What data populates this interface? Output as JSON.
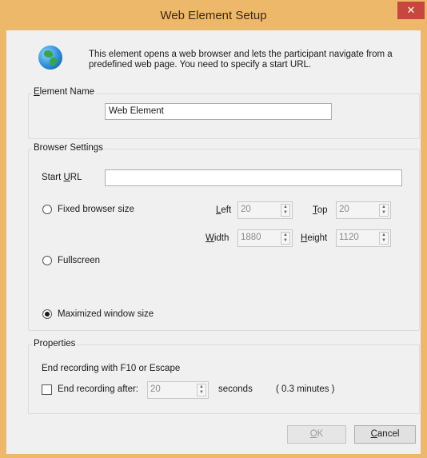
{
  "window": {
    "title": "Web Element Setup",
    "close_label": "✕"
  },
  "intro": {
    "icon": "globe-icon",
    "text": "This element opens a web browser and lets the participant navigate from a predefined web page. You need to specify a start URL."
  },
  "element_name": {
    "group_title_accel": "E",
    "group_title_rest": "lement Name",
    "value": "Web Element"
  },
  "browser_settings": {
    "group_title": "Browser Settings",
    "start_url_label_pre": "Start ",
    "start_url_label_accel": "U",
    "start_url_label_post": "RL",
    "start_url_value": "",
    "fixed_size_label": "Fixed browser size",
    "fixed_size_checked": false,
    "left_label_accel": "L",
    "left_label_rest": "eft",
    "left_value": "20",
    "top_label_accel": "T",
    "top_label_rest": "op",
    "top_value": "20",
    "width_label_accel": "W",
    "width_label_rest": "idth",
    "width_value": "1880",
    "height_label_accel": "H",
    "height_label_rest": "eight",
    "height_value": "1120",
    "fullscreen_label": "Fullscreen",
    "fullscreen_checked": false,
    "maximized_label": "Maximized window size",
    "maximized_checked": true
  },
  "properties": {
    "group_title": "Properties",
    "end_recording_text": "End recording with F10 or Escape",
    "end_after_label": "End recording after:",
    "end_after_checked": false,
    "end_after_value": "20",
    "seconds_label": "seconds",
    "minutes_label": "( 0.3 minutes )"
  },
  "buttons": {
    "ok_accel": "O",
    "ok_rest": "K",
    "cancel_accel": "C",
    "cancel_rest": "ancel"
  },
  "colors": {
    "titlebar": "#eeb86b",
    "close": "#c7463d",
    "dialog_bg": "#f0f0f0"
  }
}
